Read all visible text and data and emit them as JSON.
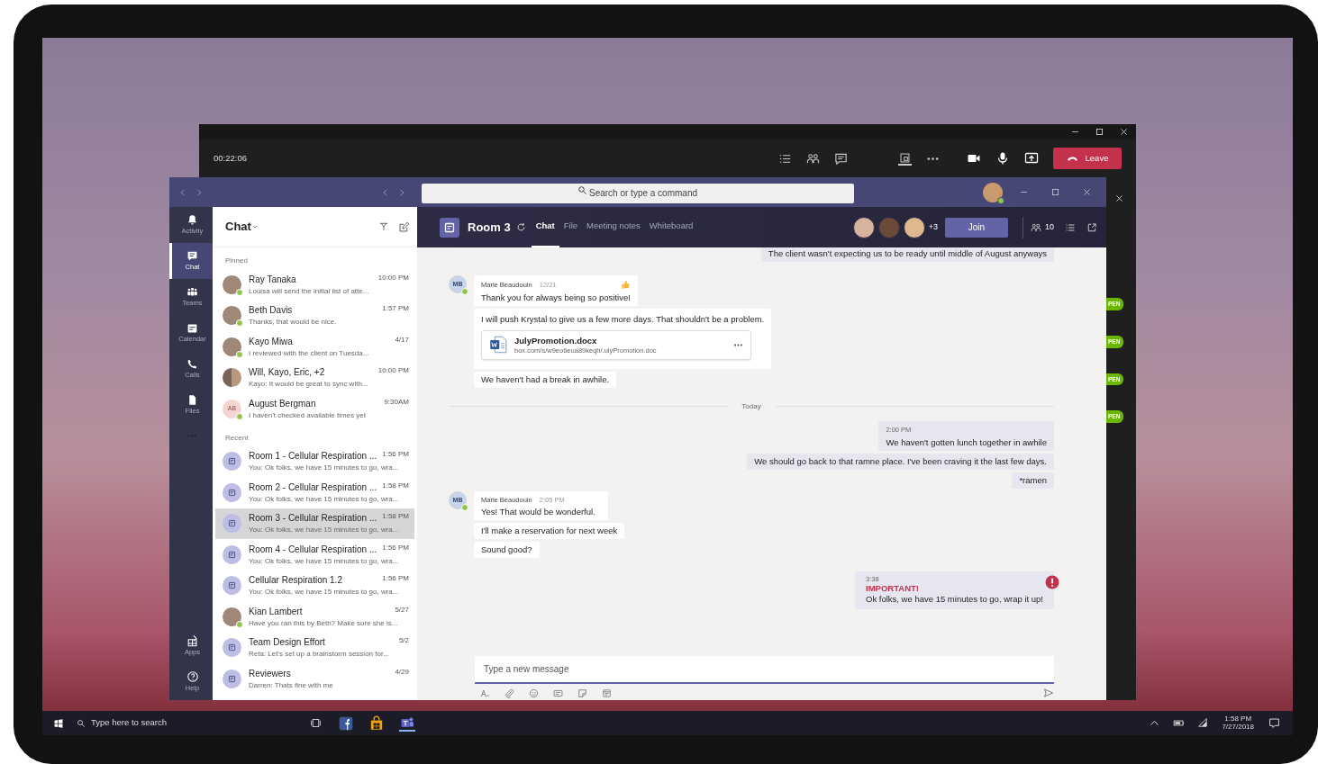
{
  "meeting_window": {
    "timer": "00:22:06",
    "leave_button": "Leave",
    "side_badges": [
      "PEN",
      "PEN",
      "PEN",
      "PEN"
    ]
  },
  "teams_window": {
    "search": {
      "placeholder": "Search or type a command"
    },
    "rail": [
      {
        "label": "Activity",
        "selected": false
      },
      {
        "label": "Chat",
        "selected": true
      },
      {
        "label": "Teams",
        "selected": false
      },
      {
        "label": "Calendar",
        "selected": false
      },
      {
        "label": "Calls",
        "selected": false
      },
      {
        "label": "Files",
        "selected": false
      }
    ],
    "rail_bottom": [
      {
        "label": "Apps"
      },
      {
        "label": "Help"
      }
    ],
    "chat_list": {
      "title": "Chat",
      "sections": [
        {
          "heading": "Pinned",
          "items": [
            {
              "name": "Ray Tanaka",
              "time": "10:00 PM",
              "preview": "Louisa will send the initial list of atte...",
              "kind": "photo",
              "online": true,
              "selected": false
            },
            {
              "name": "Beth Davis",
              "time": "1:57 PM",
              "preview": "Thanks, that would be nice.",
              "kind": "photo",
              "online": true,
              "selected": false
            },
            {
              "name": "Kayo Miwa",
              "time": "4/17",
              "preview": "I reviewed with the client on Tuesda...",
              "kind": "photo",
              "online": true,
              "selected": false
            },
            {
              "name": "Will, Kayo, Eric, +2",
              "time": "10:00 PM",
              "preview": "Kayo: It would be great to sync with...",
              "kind": "group",
              "online": false,
              "selected": false
            },
            {
              "name": "August Bergman",
              "time": "9:30AM",
              "preview": "I haven't checked available times yet",
              "kind": "initials",
              "initials": "AB",
              "online": true,
              "selected": false
            }
          ]
        },
        {
          "heading": "Recent",
          "items": [
            {
              "name": "Room 1 - Cellular Respiration ...",
              "time": "1:56 PM",
              "preview": "You: Ok folks, we have 15 minutes to go, wra...",
              "kind": "meeting",
              "online": false,
              "selected": false
            },
            {
              "name": "Room 2 - Cellular Respiration ...",
              "time": "1:58 PM",
              "preview": "You: Ok folks, we have 15 minutes to go, wra...",
              "kind": "meeting",
              "online": false,
              "selected": false
            },
            {
              "name": "Room 3 - Cellular Respiration ...",
              "time": "1:58 PM",
              "preview": "You: Ok folks, we have 15 minutes to go, wra...",
              "kind": "meeting",
              "online": false,
              "selected": true
            },
            {
              "name": "Room 4 - Cellular Respiration ...",
              "time": "1:56 PM",
              "preview": "You: Ok folks, we have 15 minutes to go, wra...",
              "kind": "meeting",
              "online": false,
              "selected": false
            },
            {
              "name": "Cellular Respiration 1.2",
              "time": "1:56 PM",
              "preview": "You: Ok folks, we have 15 minutes to go, wra...",
              "kind": "meeting",
              "online": false,
              "selected": false
            },
            {
              "name": "Kian Lambert",
              "time": "5/27",
              "preview": "Have you ran this by Beth? Make sure she is...",
              "kind": "photo",
              "online": true,
              "selected": false
            },
            {
              "name": "Team Design Effort",
              "time": "5/2",
              "preview": "Reta: Let's set up a brainstorm session for...",
              "kind": "meeting",
              "online": false,
              "selected": false
            },
            {
              "name": "Reviewers",
              "time": "4/29",
              "preview": "Darren: Thats fine with me",
              "kind": "meeting",
              "online": false,
              "selected": false
            }
          ]
        }
      ]
    },
    "channel": {
      "title": "Room 3",
      "tabs": [
        {
          "label": "Chat",
          "selected": true
        },
        {
          "label": "File",
          "selected": false
        },
        {
          "label": "Meeting notes",
          "selected": false
        },
        {
          "label": "Whiteboard",
          "selected": false
        }
      ],
      "extra_participants": "+3",
      "join_button": "Join",
      "participant_count": "10"
    },
    "messages": [
      {
        "kind": "outgoing",
        "bubbles": [
          {
            "text": "The client wasn't expecting us to be ready until middle of August anyways"
          }
        ]
      },
      {
        "kind": "incoming",
        "sender": "Marie Beaudouin",
        "time": "12/21",
        "initials": "MB",
        "online": true,
        "liked": true,
        "bubbles": [
          {
            "text": "Thank you for always being so positive!"
          },
          {
            "text": "I will push Krystal to give us a few more days. That shouldn't be a problem.",
            "attachment": {
              "name": "JulyPromotion.docx",
              "link": "box.com/s/w9eo6eua89keqh/.ulyPromotion.doc"
            }
          },
          {
            "text": "We haven't had a break in awhile."
          }
        ]
      },
      {
        "kind": "divider",
        "text": "Today"
      },
      {
        "kind": "outgoing",
        "time": "2:00 PM",
        "bubbles": [
          {
            "text": "We haven't gotten lunch together in awhile"
          },
          {
            "text": "We should go back to that ramne place. I've been craving it the last few days."
          },
          {
            "text": "*ramen"
          }
        ]
      },
      {
        "kind": "incoming",
        "sender": "Marie Beaudouin",
        "time": "2:05 PM",
        "initials": "MB",
        "online": true,
        "liked": false,
        "bubbles": [
          {
            "text": "Yes! That would be wonderful."
          },
          {
            "text": "I'll make a reservation for next week"
          },
          {
            "text": "Sound good?"
          }
        ]
      },
      {
        "kind": "important",
        "time": "3:38",
        "label": "IMPORTANT!",
        "text": "Ok folks, we have 15 minutes to go, wrap it up!"
      }
    ],
    "compose": {
      "placeholder": "Type a new message"
    }
  },
  "taskbar": {
    "search": {
      "placeholder": "Type here to search"
    },
    "time": "1:58 PM",
    "date": "7/27/2018"
  }
}
